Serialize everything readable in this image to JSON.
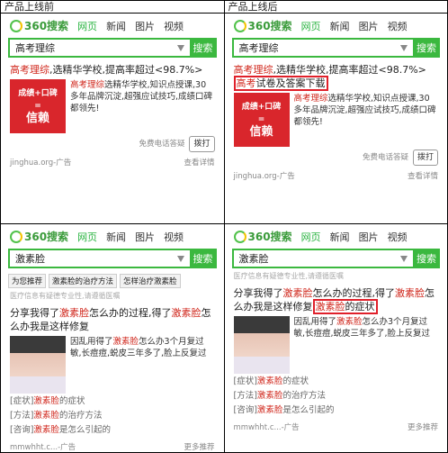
{
  "headers": {
    "before": "产品上线前",
    "after": "产品上线后"
  },
  "nav": {
    "logo": "360搜索",
    "tabs": [
      "网页",
      "新闻",
      "图片",
      "视频"
    ]
  },
  "search": {
    "button": "搜索",
    "q1": "高考理综",
    "q2": "激素脸"
  },
  "ad": {
    "title_kw": "高考理综",
    "title_rest": ",选精华学校,提高率超过<98.7%>",
    "title_extra_kw": "高考",
    "title_extra_rest": "试卷及答案下载",
    "img_top": "成绩+口碑",
    "img_eq": "=",
    "img_big": "信赖",
    "desc_kw": "高考理综",
    "desc": "选精华学校,知识点授课,30多年品牌沉淀,超强应试技巧,成绩口碑都领先!",
    "call_note": "免费电话答疑",
    "call_btn": "拨打",
    "source": "jinghua.org-广告",
    "more": "查看详情"
  },
  "med": {
    "tabs": [
      "为您推荐",
      "激素脸的治疗方法",
      "怎样治疗激素脸"
    ],
    "note": "医疗信息有疑德专业性,请遵循医嘱",
    "title_a": "分享我得了",
    "kw": "激素脸",
    "title_b": "怎么办的过程,得了",
    "title_c": "怎么办我是这样修复",
    "title_d": "的症状",
    "desc_a": "因乱用得了",
    "desc_b": "怎么办3个月复过敏,长痘痘,蜕皮三年多了,脸上反复过",
    "links": [
      {
        "tag": "[症状]",
        "rest": "的症状"
      },
      {
        "tag": "[方法]",
        "rest": "的治疗方法"
      },
      {
        "tag": "[咨询]",
        "rest": "是怎么引起的"
      }
    ],
    "source": "mmwhht.c...-广告",
    "more": "更多推荐"
  }
}
